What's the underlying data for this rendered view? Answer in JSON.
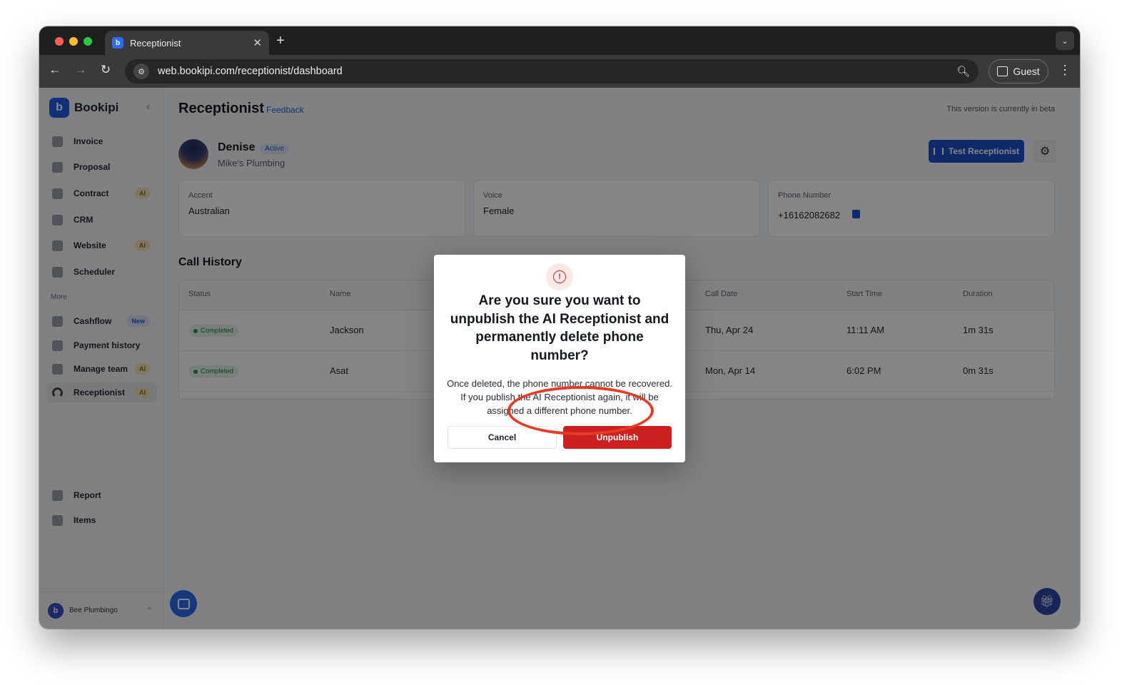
{
  "browser": {
    "tab_title": "Receptionist",
    "url": "web.bookipi.com/receptionist/dashboard",
    "profile_label": "Guest"
  },
  "sidebar": {
    "brand": "Bookipi",
    "items": [
      {
        "label": "Invoice",
        "icon": "invoice-icon",
        "badge": ""
      },
      {
        "label": "Proposal",
        "icon": "proposal-icon",
        "badge": ""
      },
      {
        "label": "Contract",
        "icon": "contract-icon",
        "badge": "AI"
      },
      {
        "label": "CRM",
        "icon": "crm-icon",
        "badge": ""
      },
      {
        "label": "Website",
        "icon": "website-icon",
        "badge": "AI"
      },
      {
        "label": "Scheduler",
        "icon": "scheduler-icon",
        "badge": ""
      }
    ],
    "more_label": "More",
    "more_items": [
      {
        "label": "Cashflow",
        "icon": "cashflow-icon",
        "badge": "New"
      },
      {
        "label": "Payment history",
        "icon": "payment-history-icon",
        "badge": ""
      },
      {
        "label": "Manage team",
        "icon": "team-icon",
        "badge": "AI"
      },
      {
        "label": "Receptionist",
        "icon": "headset-icon",
        "badge": "AI",
        "active": true
      }
    ],
    "bottom_items": [
      {
        "label": "Report",
        "icon": "report-icon"
      },
      {
        "label": "Items",
        "icon": "items-icon"
      }
    ],
    "workspace_name": "Bee Plumbingo"
  },
  "main": {
    "title": "Receptionist",
    "feedback_label": "Feedback",
    "beta_notice": "This version is currently in beta",
    "agent": {
      "name": "Denise",
      "status": "Active",
      "company": "Mike's Plumbing"
    },
    "test_button_label": "Test Receptionist",
    "cards": [
      {
        "label": "Accent",
        "value": "Australian"
      },
      {
        "label": "Voice",
        "value": "Female"
      },
      {
        "label": "Phone Number",
        "value": "+16162082682"
      }
    ],
    "call_history": {
      "title": "Call History",
      "columns": [
        "Status",
        "Name",
        "Call Date",
        "Start Time",
        "Duration"
      ],
      "rows": [
        {
          "status": "Completed",
          "name": "Jackson",
          "date": "Thu, Apr 24",
          "start": "11:11 AM",
          "duration": "1m 31s"
        },
        {
          "status": "Completed",
          "name": "Asat",
          "date": "Mon, Apr 14",
          "start": "6:02 PM",
          "duration": "0m 31s"
        }
      ]
    }
  },
  "modal": {
    "title": "Are you sure you want to unpublish the AI Receptionist and permanently delete phone number?",
    "body": "Once deleted, the phone number cannot be recovered. If you publish the AI Receptionist again, it will be assigned a different phone number.",
    "cancel_label": "Cancel",
    "confirm_label": "Unpublish"
  },
  "colors": {
    "primary": "#1d4fc9",
    "danger": "#cc1f1f",
    "highlight_ring": "#e63a24",
    "success": "#1c7a3e"
  }
}
